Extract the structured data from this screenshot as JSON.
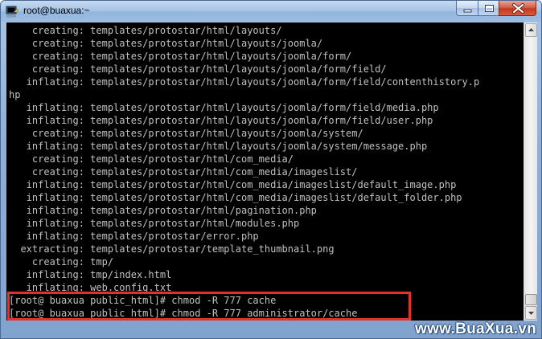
{
  "window": {
    "title": "root@buaxua:~"
  },
  "terminal": {
    "lines": [
      "    creating: templates/protostar/html/layouts/",
      "    creating: templates/protostar/html/layouts/joomla/",
      "    creating: templates/protostar/html/layouts/joomla/form/",
      "    creating: templates/protostar/html/layouts/joomla/form/field/",
      "   inflating: templates/protostar/html/layouts/joomla/form/field/contenthistory.p",
      "hp",
      "   inflating: templates/protostar/html/layouts/joomla/form/field/media.php",
      "   inflating: templates/protostar/html/layouts/joomla/form/field/user.php",
      "    creating: templates/protostar/html/layouts/joomla/system/",
      "   inflating: templates/protostar/html/layouts/joomla/system/message.php",
      "    creating: templates/protostar/html/com_media/",
      "    creating: templates/protostar/html/com_media/imageslist/",
      "   inflating: templates/protostar/html/com_media/imageslist/default_image.php",
      "   inflating: templates/protostar/html/com_media/imageslist/default_folder.php",
      "   inflating: templates/protostar/html/pagination.php",
      "   inflating: templates/protostar/html/modules.php",
      "   inflating: templates/protostar/error.php",
      "  extracting: templates/protostar/template_thumbnail.png",
      "    creating: tmp/",
      "   inflating: tmp/index.html",
      "   inflating: web.config.txt",
      "[root@ buaxua public_html]# chmod -R 777 cache",
      "[root@ buaxua public_html]# chmod -R 777 administrator/cache"
    ]
  },
  "watermark": {
    "text": "www.BuaXua.vn"
  },
  "colors": {
    "terminal_bg": "#000000",
    "terminal_fg": "#c0c0c0",
    "highlight": "#e0312f",
    "close_button": "#c2391f"
  }
}
